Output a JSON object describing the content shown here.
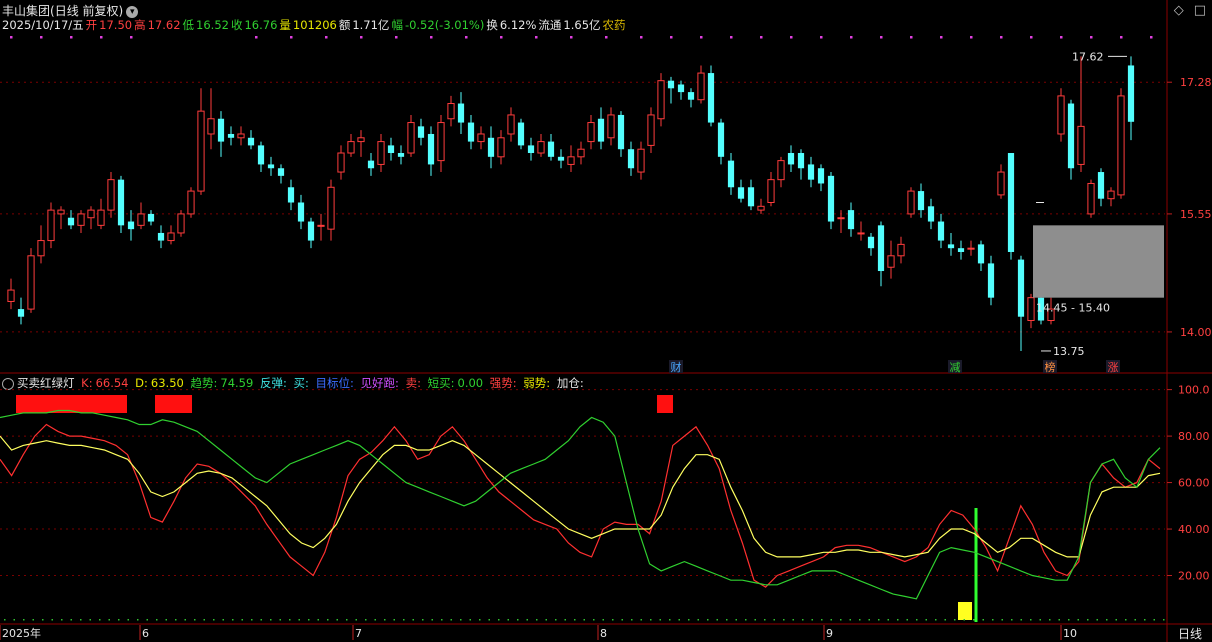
{
  "title": {
    "stock_name": "丰山集团",
    "mode": "(日线 前复权)"
  },
  "info_bar": {
    "date": "2025/10/17/五",
    "open_label": "开",
    "open": "17.50",
    "high_label": "高",
    "high": "17.62",
    "low_label": "低",
    "low": "16.52",
    "close_label": "收",
    "close": "16.76",
    "volume_label": "量",
    "volume": "101206",
    "amount_label": "额",
    "amount": "1.71亿",
    "change_label": "幅",
    "change": "-0.52(-3.01%)",
    "turnover_label": "换",
    "turnover": "6.12%",
    "float_label": "流通",
    "float": "1.65亿",
    "sector": "农药"
  },
  "window_controls": {
    "diamond": "◇",
    "square": "□"
  },
  "price_axis": {
    "ticks": [
      "17.28",
      "15.55",
      "14.00"
    ]
  },
  "annotations": {
    "high_marker": "17.62",
    "low_marker": "13.75",
    "range_box_label": "14.45 - 15.40"
  },
  "event_tags": [
    {
      "text": "财",
      "color": "#4aa8ff"
    },
    {
      "text": "减",
      "color": "#30d030"
    },
    {
      "text": "榜",
      "color": "#ff9040"
    },
    {
      "text": "涨",
      "color": "#ff4040"
    }
  ],
  "indicator": {
    "name": "买卖红绿灯",
    "k_label": "K:",
    "k_value": "66.54",
    "d_label": "D:",
    "d_value": "63.50",
    "trend_label": "趋势:",
    "trend_value": "74.59",
    "rebound_label": "反弹:",
    "buy_label": "买:",
    "target_label": "目标位:",
    "take_profit_label": "见好跑:",
    "sell_label": "卖:",
    "short_buy_label": "短买:",
    "short_buy_value": "0.00",
    "strong_label": "强势:",
    "weak_label": "弱势:",
    "add_label": "加仓:"
  },
  "indicator_axis": {
    "ticks": [
      "100.0",
      "80.00",
      "60.00",
      "40.00",
      "20.00"
    ]
  },
  "time_axis": {
    "labels": [
      "2025年",
      "6",
      "7",
      "8",
      "9",
      "10"
    ]
  },
  "period": "日线",
  "colors": {
    "up": "#ff3c3c",
    "down": "#54ffff",
    "k_line": "#ff3030",
    "d_line": "#ffff60",
    "trend_line": "#30d030"
  },
  "chart_data": [
    {
      "type": "candlestick",
      "title": "丰山集团",
      "ylim": [
        13.5,
        17.9
      ],
      "y_ticks": [
        17.28,
        15.55,
        14.0
      ],
      "x_labels": [
        "2025年",
        "6",
        "7",
        "8",
        "9",
        "10"
      ],
      "candles": [
        {
          "o": 14.4,
          "c": 14.55,
          "h": 14.7,
          "l": 14.3
        },
        {
          "o": 14.3,
          "c": 14.2,
          "h": 14.45,
          "l": 14.1
        },
        {
          "o": 14.3,
          "c": 15.0,
          "h": 15.1,
          "l": 14.25
        },
        {
          "o": 15.0,
          "c": 15.2,
          "h": 15.4,
          "l": 14.9
        },
        {
          "o": 15.2,
          "c": 15.6,
          "h": 15.7,
          "l": 15.1
        },
        {
          "o": 15.55,
          "c": 15.6,
          "h": 15.65,
          "l": 15.35
        },
        {
          "o": 15.5,
          "c": 15.4,
          "h": 15.6,
          "l": 15.35
        },
        {
          "o": 15.4,
          "c": 15.55,
          "h": 15.6,
          "l": 15.3
        },
        {
          "o": 15.5,
          "c": 15.6,
          "h": 15.65,
          "l": 15.35
        },
        {
          "o": 15.4,
          "c": 15.6,
          "h": 15.75,
          "l": 15.35
        },
        {
          "o": 15.6,
          "c": 16.0,
          "h": 16.1,
          "l": 15.5
        },
        {
          "o": 16.0,
          "c": 15.4,
          "h": 16.05,
          "l": 15.3
        },
        {
          "o": 15.45,
          "c": 15.35,
          "h": 15.6,
          "l": 15.2
        },
        {
          "o": 15.4,
          "c": 15.55,
          "h": 15.7,
          "l": 15.35
        },
        {
          "o": 15.55,
          "c": 15.45,
          "h": 15.6,
          "l": 15.4
        },
        {
          "o": 15.3,
          "c": 15.2,
          "h": 15.4,
          "l": 15.1
        },
        {
          "o": 15.2,
          "c": 15.3,
          "h": 15.4,
          "l": 15.15
        },
        {
          "o": 15.3,
          "c": 15.55,
          "h": 15.6,
          "l": 15.25
        },
        {
          "o": 15.55,
          "c": 15.85,
          "h": 15.9,
          "l": 15.5
        },
        {
          "o": 15.85,
          "c": 16.9,
          "h": 17.2,
          "l": 15.8
        },
        {
          "o": 16.6,
          "c": 16.8,
          "h": 17.2,
          "l": 16.4
        },
        {
          "o": 16.8,
          "c": 16.5,
          "h": 16.9,
          "l": 16.3
        },
        {
          "o": 16.6,
          "c": 16.55,
          "h": 16.7,
          "l": 16.45
        },
        {
          "o": 16.55,
          "c": 16.6,
          "h": 16.7,
          "l": 16.45
        },
        {
          "o": 16.55,
          "c": 16.45,
          "h": 16.65,
          "l": 16.4
        },
        {
          "o": 16.45,
          "c": 16.2,
          "h": 16.5,
          "l": 16.1
        },
        {
          "o": 16.2,
          "c": 16.15,
          "h": 16.3,
          "l": 16.05
        },
        {
          "o": 16.15,
          "c": 16.05,
          "h": 16.2,
          "l": 15.95
        },
        {
          "o": 15.9,
          "c": 15.7,
          "h": 16.0,
          "l": 15.6
        },
        {
          "o": 15.7,
          "c": 15.45,
          "h": 15.8,
          "l": 15.35
        },
        {
          "o": 15.45,
          "c": 15.2,
          "h": 15.5,
          "l": 15.1
        },
        {
          "o": 15.4,
          "c": 15.4,
          "h": 15.55,
          "l": 15.2
        },
        {
          "o": 15.35,
          "c": 15.9,
          "h": 16.0,
          "l": 15.2
        },
        {
          "o": 16.1,
          "c": 16.35,
          "h": 16.45,
          "l": 16.0
        },
        {
          "o": 16.35,
          "c": 16.5,
          "h": 16.6,
          "l": 16.3
        },
        {
          "o": 16.5,
          "c": 16.55,
          "h": 16.65,
          "l": 16.3
        },
        {
          "o": 16.25,
          "c": 16.15,
          "h": 16.35,
          "l": 16.05
        },
        {
          "o": 16.2,
          "c": 16.5,
          "h": 16.6,
          "l": 16.1
        },
        {
          "o": 16.45,
          "c": 16.35,
          "h": 16.55,
          "l": 16.25
        },
        {
          "o": 16.35,
          "c": 16.3,
          "h": 16.45,
          "l": 16.2
        },
        {
          "o": 16.35,
          "c": 16.75,
          "h": 16.85,
          "l": 16.3
        },
        {
          "o": 16.7,
          "c": 16.55,
          "h": 16.8,
          "l": 16.45
        },
        {
          "o": 16.6,
          "c": 16.2,
          "h": 16.7,
          "l": 16.05
        },
        {
          "o": 16.25,
          "c": 16.75,
          "h": 16.85,
          "l": 16.1
        },
        {
          "o": 16.8,
          "c": 17.0,
          "h": 17.1,
          "l": 16.7
        },
        {
          "o": 17.0,
          "c": 16.75,
          "h": 17.15,
          "l": 16.6
        },
        {
          "o": 16.75,
          "c": 16.5,
          "h": 16.85,
          "l": 16.4
        },
        {
          "o": 16.5,
          "c": 16.6,
          "h": 16.7,
          "l": 16.4
        },
        {
          "o": 16.55,
          "c": 16.3,
          "h": 16.7,
          "l": 16.15
        },
        {
          "o": 16.3,
          "c": 16.55,
          "h": 16.65,
          "l": 16.2
        },
        {
          "o": 16.6,
          "c": 16.85,
          "h": 16.95,
          "l": 16.5
        },
        {
          "o": 16.75,
          "c": 16.45,
          "h": 16.8,
          "l": 16.4
        },
        {
          "o": 16.45,
          "c": 16.35,
          "h": 16.55,
          "l": 16.25
        },
        {
          "o": 16.35,
          "c": 16.5,
          "h": 16.6,
          "l": 16.3
        },
        {
          "o": 16.5,
          "c": 16.3,
          "h": 16.6,
          "l": 16.25
        },
        {
          "o": 16.3,
          "c": 16.25,
          "h": 16.4,
          "l": 16.15
        },
        {
          "o": 16.2,
          "c": 16.3,
          "h": 16.45,
          "l": 16.1
        },
        {
          "o": 16.3,
          "c": 16.4,
          "h": 16.5,
          "l": 16.2
        },
        {
          "o": 16.5,
          "c": 16.75,
          "h": 16.85,
          "l": 16.4
        },
        {
          "o": 16.8,
          "c": 16.5,
          "h": 16.95,
          "l": 16.4
        },
        {
          "o": 16.55,
          "c": 16.85,
          "h": 16.95,
          "l": 16.45
        },
        {
          "o": 16.85,
          "c": 16.4,
          "h": 16.9,
          "l": 16.3
        },
        {
          "o": 16.4,
          "c": 16.15,
          "h": 16.5,
          "l": 16.05
        },
        {
          "o": 16.1,
          "c": 16.4,
          "h": 16.5,
          "l": 16.0
        },
        {
          "o": 16.45,
          "c": 16.85,
          "h": 16.95,
          "l": 16.35
        },
        {
          "o": 16.8,
          "c": 17.3,
          "h": 17.4,
          "l": 16.7
        },
        {
          "o": 17.3,
          "c": 17.2,
          "h": 17.35,
          "l": 17.0
        },
        {
          "o": 17.25,
          "c": 17.15,
          "h": 17.3,
          "l": 17.05
        },
        {
          "o": 17.15,
          "c": 17.05,
          "h": 17.2,
          "l": 16.95
        },
        {
          "o": 17.05,
          "c": 17.4,
          "h": 17.5,
          "l": 17.0
        },
        {
          "o": 17.4,
          "c": 16.75,
          "h": 17.5,
          "l": 16.7
        },
        {
          "o": 16.75,
          "c": 16.3,
          "h": 16.8,
          "l": 16.2
        },
        {
          "o": 16.25,
          "c": 15.9,
          "h": 16.35,
          "l": 15.8
        },
        {
          "o": 15.9,
          "c": 15.75,
          "h": 16.0,
          "l": 15.7
        },
        {
          "o": 15.9,
          "c": 15.65,
          "h": 16.0,
          "l": 15.6
        },
        {
          "o": 15.6,
          "c": 15.65,
          "h": 15.75,
          "l": 15.55
        },
        {
          "o": 15.7,
          "c": 16.0,
          "h": 16.1,
          "l": 15.65
        },
        {
          "o": 16.0,
          "c": 16.25,
          "h": 16.3,
          "l": 15.9
        },
        {
          "o": 16.35,
          "c": 16.2,
          "h": 16.45,
          "l": 16.1
        },
        {
          "o": 16.35,
          "c": 16.15,
          "h": 16.4,
          "l": 16.0
        },
        {
          "o": 16.2,
          "c": 16.0,
          "h": 16.3,
          "l": 15.9
        },
        {
          "o": 16.15,
          "c": 15.95,
          "h": 16.2,
          "l": 15.85
        },
        {
          "o": 16.05,
          "c": 15.45,
          "h": 16.1,
          "l": 15.35
        },
        {
          "o": 15.5,
          "c": 15.5,
          "h": 15.6,
          "l": 15.3
        },
        {
          "o": 15.6,
          "c": 15.35,
          "h": 15.7,
          "l": 15.25
        },
        {
          "o": 15.3,
          "c": 15.3,
          "h": 15.45,
          "l": 15.2
        },
        {
          "o": 15.25,
          "c": 15.1,
          "h": 15.3,
          "l": 15.0
        },
        {
          "o": 15.4,
          "c": 14.8,
          "h": 15.45,
          "l": 14.6
        },
        {
          "o": 14.85,
          "c": 15.0,
          "h": 15.2,
          "l": 14.7
        },
        {
          "o": 15.0,
          "c": 15.15,
          "h": 15.25,
          "l": 14.9
        },
        {
          "o": 15.55,
          "c": 15.85,
          "h": 15.9,
          "l": 15.5
        },
        {
          "o": 15.85,
          "c": 15.6,
          "h": 15.95,
          "l": 15.5
        },
        {
          "o": 15.65,
          "c": 15.45,
          "h": 15.75,
          "l": 15.35
        },
        {
          "o": 15.45,
          "c": 15.2,
          "h": 15.55,
          "l": 15.1
        },
        {
          "o": 15.15,
          "c": 15.1,
          "h": 15.3,
          "l": 15.0
        },
        {
          "o": 15.1,
          "c": 15.05,
          "h": 15.2,
          "l": 14.95
        },
        {
          "o": 15.1,
          "c": 15.1,
          "h": 15.2,
          "l": 15.0
        },
        {
          "o": 15.15,
          "c": 14.9,
          "h": 15.2,
          "l": 14.8
        },
        {
          "o": 14.9,
          "c": 14.45,
          "h": 15.0,
          "l": 14.35
        },
        {
          "o": 15.8,
          "c": 16.1,
          "h": 16.2,
          "l": 15.75
        },
        {
          "o": 16.35,
          "c": 15.05,
          "h": 16.35,
          "l": 14.95
        },
        {
          "o": 14.95,
          "c": 14.2,
          "h": 15.0,
          "l": 13.75
        },
        {
          "o": 14.15,
          "c": 14.45,
          "h": 14.5,
          "l": 14.05
        },
        {
          "o": 14.45,
          "c": 14.15,
          "h": 14.5,
          "l": 14.1
        },
        {
          "o": 14.15,
          "c": 14.3,
          "h": 14.45,
          "l": 14.1
        },
        {
          "o": 16.6,
          "c": 17.1,
          "h": 17.2,
          "l": 16.5
        },
        {
          "o": 17.0,
          "c": 16.15,
          "h": 17.05,
          "l": 16.0
        },
        {
          "o": 16.2,
          "c": 16.7,
          "h": 17.62,
          "l": 16.1
        },
        {
          "o": 15.55,
          "c": 15.95,
          "h": 16.0,
          "l": 15.5
        },
        {
          "o": 16.1,
          "c": 15.75,
          "h": 16.15,
          "l": 15.65
        },
        {
          "o": 15.75,
          "c": 15.85,
          "h": 15.9,
          "l": 15.65
        },
        {
          "o": 15.8,
          "c": 17.1,
          "h": 17.2,
          "l": 15.75
        },
        {
          "o": 17.5,
          "c": 16.76,
          "h": 17.62,
          "l": 16.52
        }
      ]
    },
    {
      "type": "line",
      "title": "买卖红绿灯",
      "ylim": [
        0,
        105
      ],
      "y_ticks": [
        100,
        80,
        60,
        40,
        20
      ],
      "series": [
        {
          "name": "K",
          "color": "#ff3030",
          "values": [
            70,
            63,
            72,
            80,
            85,
            82,
            80,
            80,
            79,
            78,
            76,
            72,
            60,
            45,
            43,
            52,
            62,
            68,
            67,
            64,
            60,
            55,
            50,
            42,
            35,
            28,
            24,
            20,
            30,
            45,
            63,
            70,
            73,
            78,
            84,
            78,
            70,
            72,
            80,
            84,
            78,
            70,
            62,
            56,
            52,
            48,
            44,
            42,
            40,
            34,
            30,
            28,
            40,
            43,
            42,
            42,
            38,
            52,
            76,
            80,
            84,
            76,
            66,
            48,
            34,
            18,
            15,
            20,
            22,
            24,
            26,
            28,
            32,
            33,
            33,
            32,
            30,
            28,
            26,
            28,
            32,
            42,
            48,
            46,
            40,
            32,
            22,
            36,
            50,
            42,
            30,
            22,
            20,
            26,
            60,
            68,
            62,
            58,
            60,
            70,
            66
          ]
        },
        {
          "name": "D",
          "color": "#ffff60",
          "values": [
            80,
            74,
            76,
            77,
            78,
            77,
            76,
            76,
            75,
            74,
            72,
            70,
            64,
            56,
            54,
            56,
            60,
            64,
            65,
            64,
            62,
            58,
            54,
            50,
            44,
            38,
            34,
            32,
            36,
            42,
            52,
            60,
            66,
            72,
            76,
            76,
            74,
            74,
            76,
            78,
            76,
            72,
            68,
            64,
            60,
            56,
            52,
            48,
            44,
            40,
            38,
            36,
            38,
            40,
            40,
            40,
            40,
            46,
            58,
            66,
            72,
            72,
            70,
            58,
            48,
            36,
            30,
            28,
            28,
            28,
            29,
            30,
            30,
            31,
            31,
            30,
            30,
            29,
            28,
            29,
            30,
            36,
            40,
            40,
            38,
            34,
            30,
            32,
            36,
            36,
            33,
            30,
            28,
            28,
            46,
            56,
            58,
            58,
            58,
            63,
            64
          ]
        },
        {
          "name": "趋势",
          "color": "#30d030",
          "values": [
            88,
            89,
            90,
            90,
            90,
            91,
            91,
            90,
            90,
            89,
            88,
            87,
            85,
            85,
            87,
            86,
            84,
            82,
            78,
            74,
            70,
            66,
            62,
            60,
            64,
            68,
            70,
            72,
            74,
            76,
            78,
            76,
            72,
            68,
            64,
            60,
            58,
            56,
            54,
            52,
            50,
            52,
            56,
            60,
            64,
            66,
            68,
            70,
            74,
            78,
            84,
            88,
            86,
            80,
            60,
            40,
            25,
            22,
            24,
            26,
            24,
            22,
            20,
            18,
            18,
            17,
            16,
            16,
            18,
            20,
            22,
            22,
            22,
            20,
            18,
            16,
            14,
            12,
            11,
            10,
            20,
            30,
            32,
            31,
            30,
            28,
            26,
            24,
            22,
            20,
            19,
            18,
            18,
            28,
            60,
            68,
            70,
            62,
            58,
            70,
            75
          ]
        }
      ]
    }
  ]
}
